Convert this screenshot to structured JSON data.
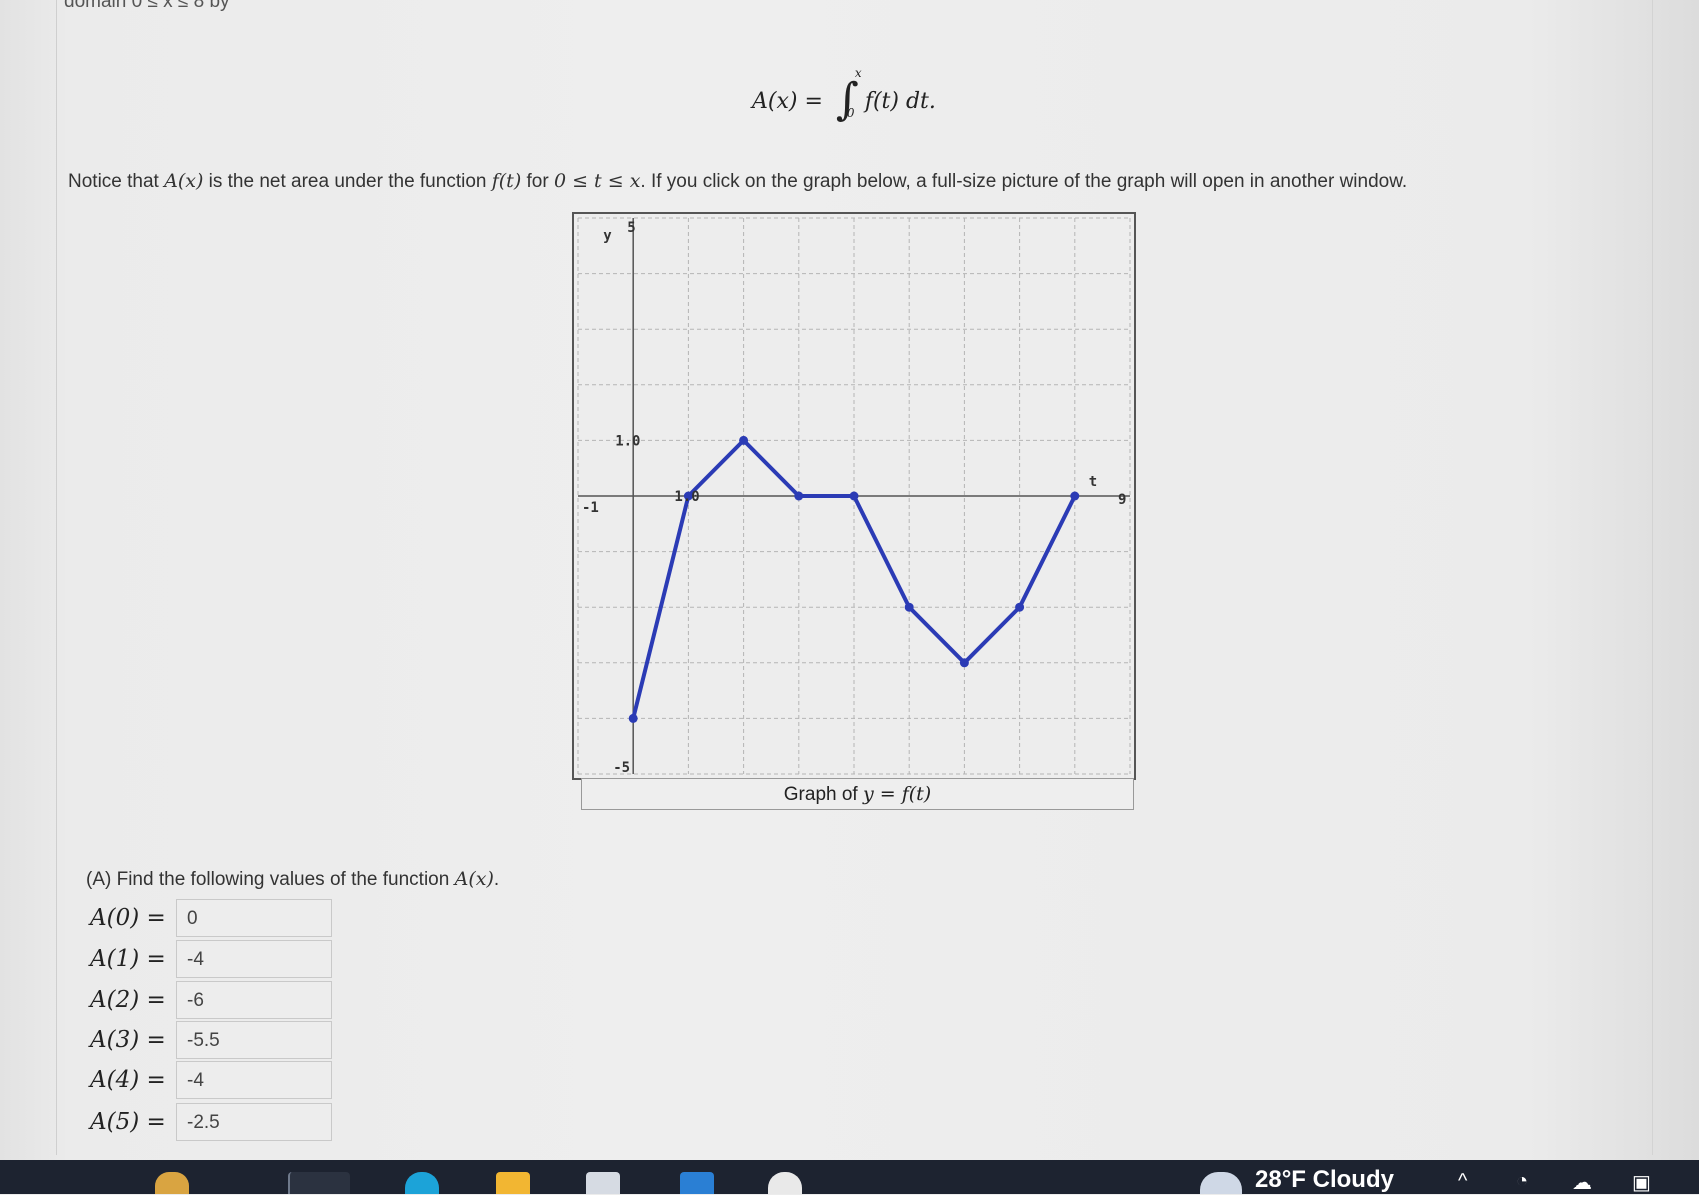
{
  "header": {
    "top_clip": "domain 0 ≤ x ≤ 8 by"
  },
  "formula": {
    "lhs": "A(x) = ",
    "upper": "x",
    "lower": "0",
    "integrand": "f(t) dt."
  },
  "notice": {
    "p1": "Notice that ",
    "m1": "A(x)",
    "p2": " is the net area under the function ",
    "m2": "f(t)",
    "p3": " for ",
    "m3": "0 ≤ t ≤ x",
    "p4": ". If you click on the graph below, a full-size picture of the graph will open in another window."
  },
  "graph": {
    "caption_text": "Graph of ",
    "caption_math": "y = f(t)",
    "tick_labels": {
      "y_top": "5",
      "y_axis": "y",
      "y_one": "1.0",
      "y_bottom": "-5",
      "x_left": "-1",
      "x_one": "1.0",
      "t_axis": "t",
      "x_right": "9"
    }
  },
  "chart_data": {
    "type": "line",
    "title": "Graph of y = f(t)",
    "xlabel": "t",
    "ylabel": "y",
    "xlim": [
      -1,
      9
    ],
    "ylim": [
      -5,
      5
    ],
    "grid": true,
    "series": [
      {
        "x": [
          0,
          1,
          2,
          3,
          4,
          5,
          6,
          7,
          8
        ],
        "values": [
          -4,
          0,
          1,
          0,
          0,
          -2,
          -3,
          -2,
          0
        ]
      }
    ]
  },
  "part_a": {
    "prompt_text": "(A) Find the following values of the function ",
    "prompt_math": "A(x)",
    "prompt_end": ".",
    "rows": [
      {
        "label": "A(0) =",
        "value": "0"
      },
      {
        "label": "A(1) =",
        "value": "-4"
      },
      {
        "label": "A(2) =",
        "value": "-6"
      },
      {
        "label": "A(3) =",
        "value": "-5.5"
      },
      {
        "label": "A(4) =",
        "value": "-4"
      },
      {
        "label": "A(5) =",
        "value": "-2.5"
      }
    ]
  },
  "taskbar": {
    "weather": "28°F Cloudy"
  },
  "colors": {
    "series": "#2b3bb5",
    "grid": "#b5b5b5",
    "axis": "#555555",
    "taskbar": "#1d2330"
  }
}
